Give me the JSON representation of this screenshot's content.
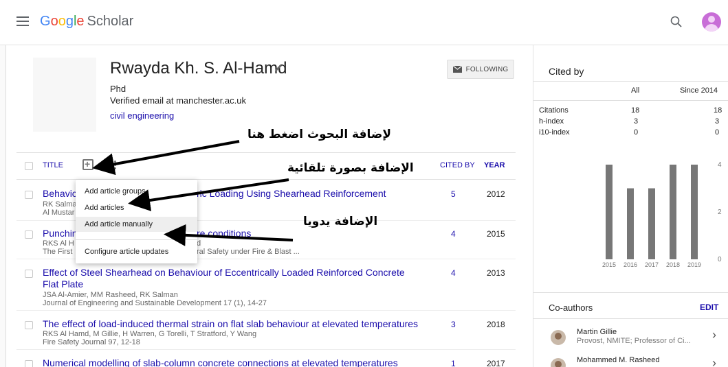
{
  "header": {
    "logo_google": [
      "G",
      "o",
      "o",
      "g",
      "l",
      "e"
    ],
    "logo_product": "Scholar"
  },
  "profile": {
    "name": "Rwayda Kh. S. Al-Hamd",
    "degree": "Phd",
    "email": "Verified email at manchester.ac.uk",
    "interest": "civil engineering",
    "follow_label": "FOLLOWING"
  },
  "table": {
    "title_header": "TITLE",
    "cited_header": "CITED BY",
    "year_header": "YEAR",
    "rows": [
      {
        "title": "Behavic",
        "title_tail": "ric Loading Using Shearhead Reinforcement",
        "authors": "RK Salma",
        "venue": "Al Mustar",
        "cites": "5",
        "year": "2012"
      },
      {
        "title": "Punchin",
        "title_tail": "re conditions",
        "authors": "RKS Al H",
        "authors_tail": "d",
        "venue": "The First",
        "venue_tail": "ral Safety under Fire & Blast ...",
        "cites": "4",
        "year": "2015"
      },
      {
        "title": "Effect of Steel Shearhead on Behaviour of Eccentrically Loaded Reinforced Concrete",
        "title2": "Flat Plate",
        "authors": "JSA Al-Amier, MM Rasheed, RK Salman",
        "venue": "Journal of Engineering and Sustainable Development 17 (1), 14-27",
        "cites": "4",
        "year": "2013"
      },
      {
        "title": "The effect of load-induced thermal strain on flat slab behaviour at elevated temperatures",
        "authors": "RKS Al Hamd, M Gillie, H Warren, G Torelli, T Stratford, Y Wang",
        "venue": "Fire Safety Journal 97, 12-18",
        "cites": "3",
        "year": "2018"
      },
      {
        "title": "Numerical modelling of slab-column concrete connections at elevated temperatures",
        "cites": "1",
        "year": "2017"
      }
    ]
  },
  "dropdown": {
    "items": [
      "Add article groups",
      "Add articles",
      "Add article manually",
      "Configure article updates"
    ]
  },
  "annotations": {
    "add_research": "لإضافة البحوث اضغط هنا",
    "add_auto": "الإضافة بصورة تلقائية",
    "add_manual": "الإضافة يدويا"
  },
  "cited_by": {
    "title": "Cited by",
    "col_all": "All",
    "col_since": "Since 2014",
    "metrics": [
      {
        "label": "Citations",
        "all": "18",
        "since": "18"
      },
      {
        "label": "h-index",
        "all": "3",
        "since": "3"
      },
      {
        "label": "i10-index",
        "all": "0",
        "since": "0"
      }
    ]
  },
  "chart_data": {
    "type": "bar",
    "categories": [
      "2015",
      "2016",
      "2017",
      "2018",
      "2019"
    ],
    "values": [
      4,
      3,
      3,
      4,
      4
    ],
    "ylim": [
      0,
      4
    ],
    "yticks": [
      "4",
      "2",
      "0"
    ]
  },
  "coauthors": {
    "title": "Co-authors",
    "edit_label": "EDIT",
    "items": [
      {
        "name": "Martin Gillie",
        "affiliation": "Provost, NMITE; Professor of Ci..."
      },
      {
        "name": "Mohammed M. Rasheed",
        "affiliation": ""
      }
    ]
  },
  "colors": {
    "link": "#1a0dab",
    "bar": "#777777",
    "accent": "#c86dd7"
  }
}
